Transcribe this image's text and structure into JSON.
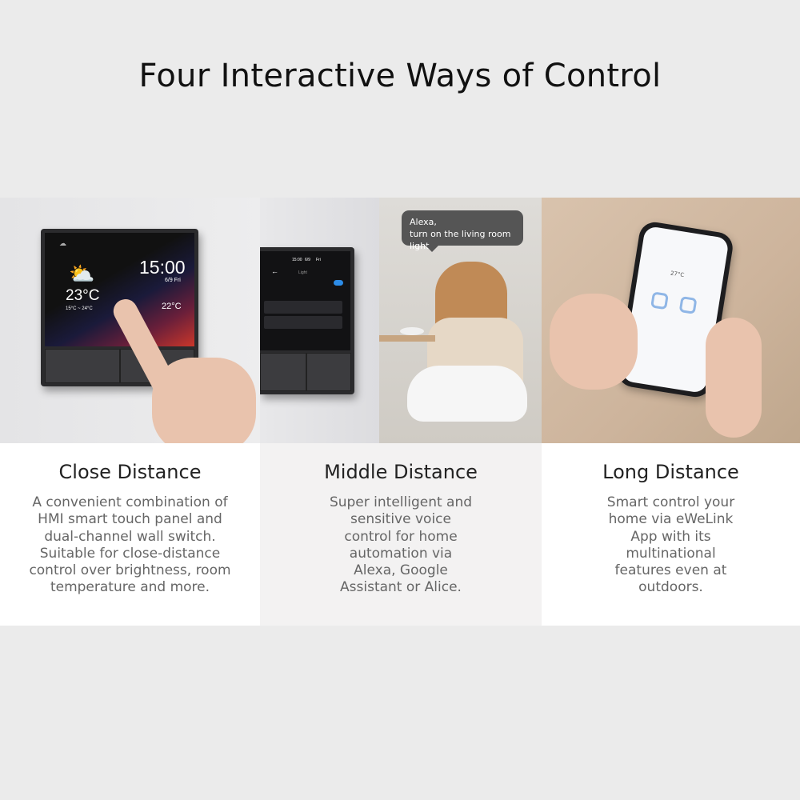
{
  "title": "Four Interactive Ways of Control",
  "photos": {
    "panel_close": {
      "time": "15:00",
      "date": "6/9  Fri",
      "temp_outdoor": "23°C",
      "temp_range": "15°C ~ 24°C",
      "temp_indoor": "22°C"
    },
    "panel_middle": {
      "status_time": "15:00",
      "status_date": "6/9",
      "status_day": "Fri",
      "screen_title": "Light"
    },
    "voice": {
      "speech_bubble": "Alexa,\nturn on the living room light."
    },
    "phone": {
      "temperature": "27°C"
    }
  },
  "columns": [
    {
      "heading": "Close Distance",
      "description": "A convenient combination of\nHMI smart touch panel and\ndual-channel wall switch.\nSuitable for close-distance\ncontrol over brightness, room\ntemperature and more."
    },
    {
      "heading": "Middle Distance",
      "description": "Super intelligent and\nsensitive voice\ncontrol for home\nautomation via\nAlexa, Google\nAssistant or Alice."
    },
    {
      "heading": "Long Distance",
      "description": "Smart control your\nhome via eWeLink\nApp with its\nmultinational\nfeatures even at\noutdoors."
    }
  ]
}
